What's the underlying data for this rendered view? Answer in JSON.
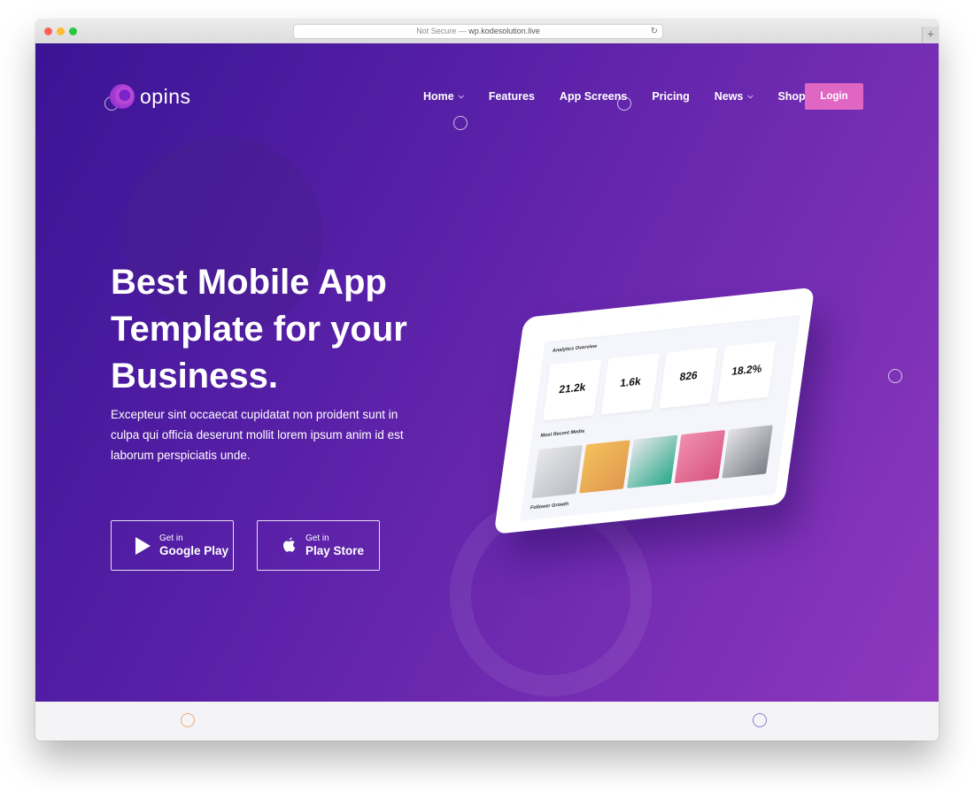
{
  "browser": {
    "address_prefix": "Not Secure —",
    "address_domain": "wp.kodesolution.live",
    "reload_icon": "reload-icon",
    "new_tab_icon": "plus-icon",
    "traffic_lights": [
      "#ff5f57",
      "#febc2e",
      "#28c840"
    ]
  },
  "brand": {
    "name": "opins",
    "logo_colors": [
      "#7a25c9",
      "#c34bd6"
    ]
  },
  "nav": {
    "items": [
      {
        "label": "Home",
        "has_dropdown": true
      },
      {
        "label": "Features",
        "has_dropdown": false
      },
      {
        "label": "App Screens",
        "has_dropdown": false
      },
      {
        "label": "Pricing",
        "has_dropdown": false
      },
      {
        "label": "News",
        "has_dropdown": true
      },
      {
        "label": "Shop",
        "has_dropdown": true
      }
    ],
    "login_label": "Login"
  },
  "hero": {
    "headline": "Best Mobile App Template for your Business.",
    "subtext": "Excepteur sint occaecat cupidatat non proident sunt in culpa qui officia deserunt mollit lorem ipsum anim id est laborum perspiciatis unde.",
    "buttons": [
      {
        "small": "Get in",
        "big": "Google Play",
        "icon": "play-icon"
      },
      {
        "small": "Get in",
        "big": "Play Store",
        "icon": "apple-icon"
      }
    ],
    "gradient": [
      "#3a1494",
      "#5a21a8",
      "#8e38bd"
    ],
    "accent": "#e066c3"
  },
  "tablet": {
    "title": "Analytics Overview",
    "stats": [
      "21.2k",
      "1.6k",
      "826",
      "18.2%"
    ],
    "section": "Most Recent Media",
    "footer": "Follower Growth"
  }
}
